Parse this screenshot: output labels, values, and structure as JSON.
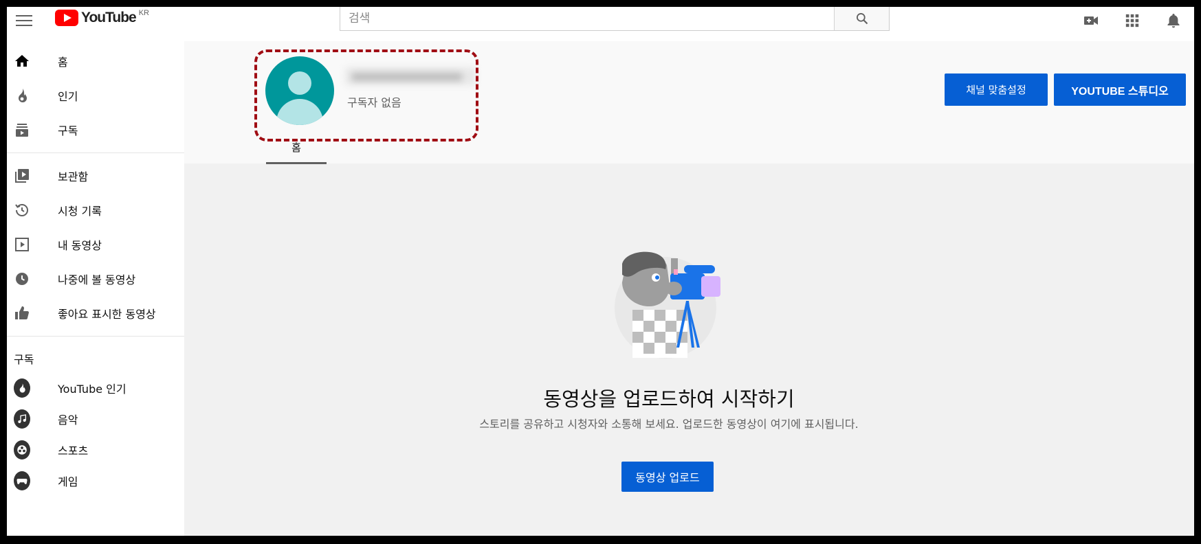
{
  "topbar": {
    "logo_text": "YouTube",
    "logo_country": "KR",
    "search_placeholder": "검색"
  },
  "sidebar": {
    "primary": [
      {
        "label": "홈",
        "icon": "home-icon"
      },
      {
        "label": "인기",
        "icon": "trending-icon"
      },
      {
        "label": "구독",
        "icon": "subscriptions-icon"
      }
    ],
    "library": [
      {
        "label": "보관함",
        "icon": "library-icon"
      },
      {
        "label": "시청 기록",
        "icon": "history-icon"
      },
      {
        "label": "내 동영상",
        "icon": "my-videos-icon"
      },
      {
        "label": "나중에 볼 동영상",
        "icon": "watch-later-icon"
      },
      {
        "label": "좋아요 표시한 동영상",
        "icon": "liked-videos-icon"
      }
    ],
    "subscriptions_title": "구독",
    "subscriptions": [
      {
        "label": "YouTube 인기"
      },
      {
        "label": "음악"
      },
      {
        "label": "스포츠"
      },
      {
        "label": "게임"
      }
    ]
  },
  "channel": {
    "subscribers": "구독자 없음",
    "customize_label": "채널 맞춤설정",
    "studio_label": "YOUTUBE 스튜디오",
    "tab_home": "홈"
  },
  "empty_state": {
    "title": "동영상을 업로드하여 시작하기",
    "description": "스토리를 공유하고 시청자와 소통해 보세요. 업로드한 동영상이 여기에 표시됩니다.",
    "upload_label": "동영상 업로드"
  },
  "colors": {
    "accent": "#065fd4",
    "logo_red": "#ff0000",
    "highlight": "#a00d14",
    "avatar": "#00979b"
  }
}
